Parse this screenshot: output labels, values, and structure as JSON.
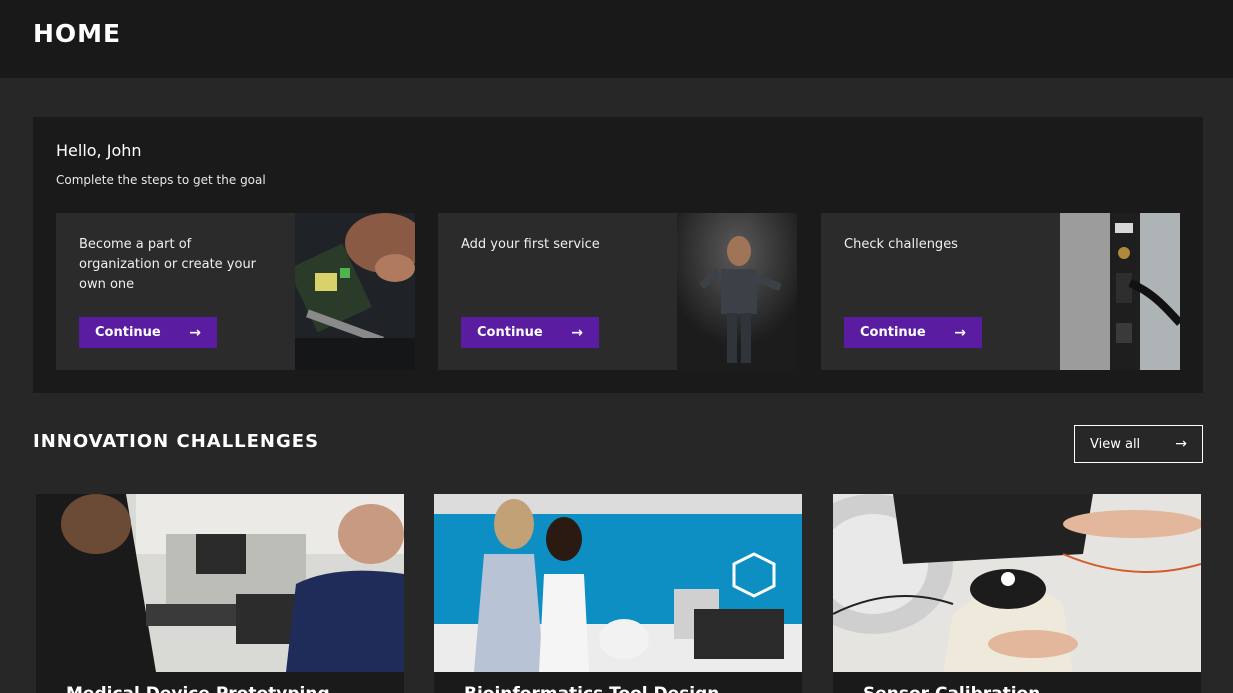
{
  "header": {
    "title": "HOME"
  },
  "welcome": {
    "greeting": "Hello, John",
    "subtitle": "Complete the steps to get the goal",
    "steps": [
      {
        "text": "Become a part of organization or create your own one",
        "button": "Continue",
        "arrow": "→"
      },
      {
        "text": "Add your first service",
        "button": "Continue",
        "arrow": "→"
      },
      {
        "text": "Check challenges",
        "button": "Continue",
        "arrow": "→"
      }
    ]
  },
  "challenges": {
    "title": "INNOVATION CHALLENGES",
    "view_all": "View all",
    "view_all_arrow": "→",
    "cards": [
      {
        "title": "Medical Device Prototyping"
      },
      {
        "title": "Bioinformatics Tool Design"
      },
      {
        "title": "Sensor Calibration"
      }
    ]
  },
  "colors": {
    "accent": "#5a1ca0",
    "background": "#272727",
    "panel": "#1a1a1a"
  }
}
